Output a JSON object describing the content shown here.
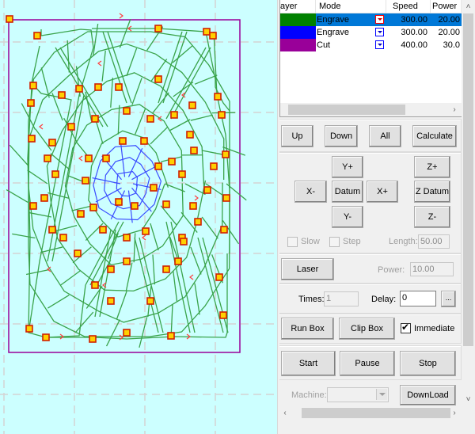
{
  "colors": {
    "canvas_bg": "#ccffff",
    "grid": "#d4d4d4",
    "engrave_green": "#008000",
    "engrave_blue": "#0000ff",
    "cut_purple": "#990099",
    "path_green": "#3aa34a",
    "path_blue": "#3a4cff",
    "node_fill": "#ffd000",
    "node_ring": "#d02000",
    "arrow_red": "#ff4040",
    "selection_blue": "#0078d7"
  },
  "layer_list": {
    "headers": [
      "ayer",
      "Mode",
      "Speed",
      "Power"
    ],
    "rows": [
      {
        "color": "#008000",
        "mode": "Engrave",
        "speed": "300.00",
        "power": "20.00",
        "selected": true
      },
      {
        "color": "#0000ff",
        "mode": "Engrave",
        "speed": "300.00",
        "power": "20.00",
        "selected": false
      },
      {
        "color": "#990099",
        "mode": "Cut",
        "speed": "400.00",
        "power": "30.0",
        "selected": false
      }
    ],
    "scroll_right_icon": "›"
  },
  "order_buttons": {
    "up": "Up",
    "down": "Down",
    "all": "All",
    "calculate": "Calculate"
  },
  "jog": {
    "y_plus": "Y+",
    "x_minus": "X-",
    "datum": "Datum",
    "x_plus": "X+",
    "y_minus": "Y-",
    "z_plus": "Z+",
    "z_datum": "Z Datum",
    "z_minus": "Z-",
    "slow_label": "Slow",
    "step_label": "Step",
    "length_label": "Length:",
    "length_value": "50.00"
  },
  "laser": {
    "button": "Laser",
    "power_label": "Power:",
    "power_value": "10.00"
  },
  "repeat": {
    "times_label": "Times:",
    "times_value": "1",
    "delay_label": "Delay:",
    "delay_value": "0",
    "browse": "..."
  },
  "box": {
    "run_box": "Run Box",
    "clip_box": "Clip Box",
    "immediate_label": "Immediate",
    "immediate_checked": true
  },
  "control": {
    "start": "Start",
    "pause": "Pause",
    "stop": "Stop"
  },
  "machine": {
    "label": "Machine:",
    "value": "",
    "download": "DownLoad"
  },
  "scrollbar": {
    "up": "˄",
    "down": "˅",
    "left": "‹",
    "right": "›"
  }
}
